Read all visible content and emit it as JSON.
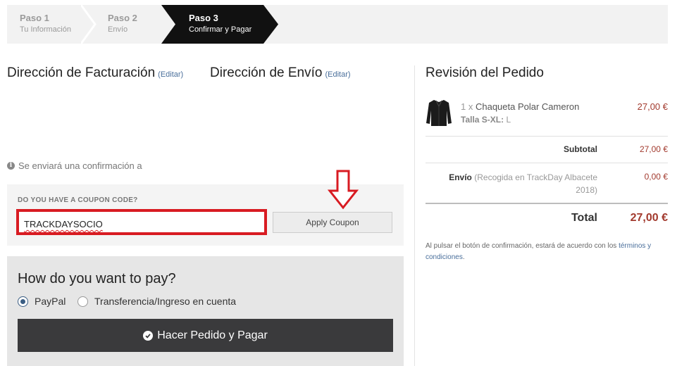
{
  "steps": [
    {
      "title": "Paso 1",
      "subtitle": "Tu Información"
    },
    {
      "title": "Paso 2",
      "subtitle": "Envío"
    },
    {
      "title": "Paso 3",
      "subtitle": "Confirmar y Pagar"
    }
  ],
  "billing": {
    "title": "Dirección de Facturación",
    "edit": "(Editar)"
  },
  "shipping_address": {
    "title": "Dirección de Envío",
    "edit": "(Editar)"
  },
  "confirmation_note": "Se enviará una confirmación a",
  "coupon": {
    "label": "DO YOU HAVE A COUPON CODE?",
    "value": "TRACKDAYSOCIO",
    "button": "Apply Coupon"
  },
  "payment": {
    "title": "How do you want to pay?",
    "options": [
      {
        "label": "PayPal",
        "selected": true
      },
      {
        "label": "Transferencia/Ingreso en cuenta",
        "selected": false
      }
    ],
    "place_order": "Hacer Pedido y Pagar"
  },
  "review": {
    "title": "Revisión del Pedido",
    "item": {
      "qty": "1 x",
      "name": "Chaqueta Polar Cameron",
      "size_label": "Talla S-XL:",
      "size_value": "L",
      "price": "27,00 €"
    },
    "subtotal_label": "Subtotal",
    "subtotal": "27,00 €",
    "shipping_label": "Envío",
    "shipping_detail": "(Recogida en TrackDay Albacete 2018)",
    "shipping": "0,00 €",
    "total_label": "Total",
    "total": "27,00 €",
    "terms_prefix": "Al pulsar el botón de confirmación, estará de acuerdo con los",
    "terms_link": "términos y condiciones",
    "terms_suffix": "."
  },
  "colors": {
    "accent_red": "#d81b22",
    "price_red": "#a23a2e",
    "dark_button": "#3a3a3c",
    "link_blue": "#4a6f9b"
  }
}
